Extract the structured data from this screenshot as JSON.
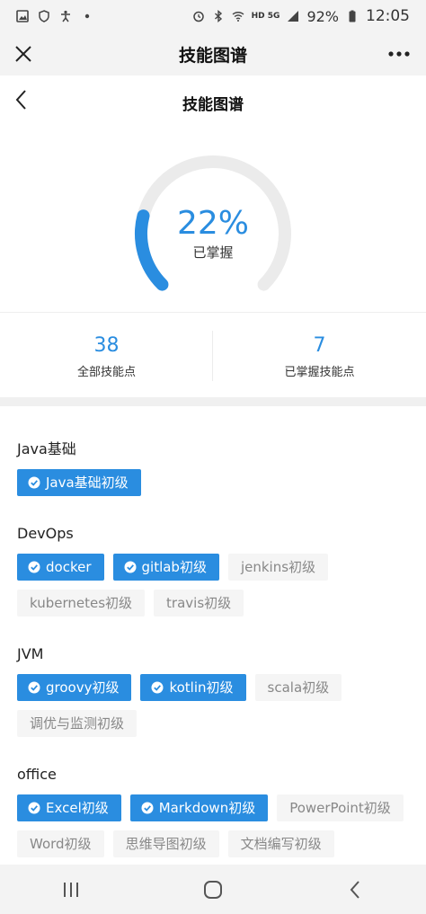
{
  "status_bar": {
    "battery_percent": "92%",
    "time": "12:05",
    "network": "HD 5G"
  },
  "nav": {
    "title": "技能图谱"
  },
  "page": {
    "title": "技能图谱"
  },
  "progress": {
    "percent_text": "22%",
    "value": 0.22,
    "label": "已掌握"
  },
  "stats": {
    "total_value": "38",
    "total_label": "全部技能点",
    "mastered_value": "7",
    "mastered_label": "已掌握技能点"
  },
  "colors": {
    "accent": "#2a8de0",
    "ring_track": "#ebebeb",
    "tag_off_bg": "#f5f5f5",
    "tag_off_text": "#888888"
  },
  "sections": [
    {
      "title": "Java基础",
      "tags": [
        {
          "label": "Java基础初级",
          "mastered": true
        }
      ]
    },
    {
      "title": "DevOps",
      "tags": [
        {
          "label": "docker",
          "mastered": true
        },
        {
          "label": "gitlab初级",
          "mastered": true
        },
        {
          "label": "jenkins初级",
          "mastered": false
        },
        {
          "label": "kubernetes初级",
          "mastered": false
        },
        {
          "label": "travis初级",
          "mastered": false
        }
      ]
    },
    {
      "title": "JVM",
      "tags": [
        {
          "label": "groovy初级",
          "mastered": true
        },
        {
          "label": "kotlin初级",
          "mastered": true
        },
        {
          "label": "scala初级",
          "mastered": false
        },
        {
          "label": "调优与监测初级",
          "mastered": false
        }
      ]
    },
    {
      "title": "office",
      "tags": [
        {
          "label": "Excel初级",
          "mastered": true
        },
        {
          "label": "Markdown初级",
          "mastered": true
        },
        {
          "label": "PowerPoint初级",
          "mastered": false
        },
        {
          "label": "Word初级",
          "mastered": false
        },
        {
          "label": "思维导图初级",
          "mastered": false
        },
        {
          "label": "文档编写初级",
          "mastered": false
        }
      ]
    }
  ]
}
